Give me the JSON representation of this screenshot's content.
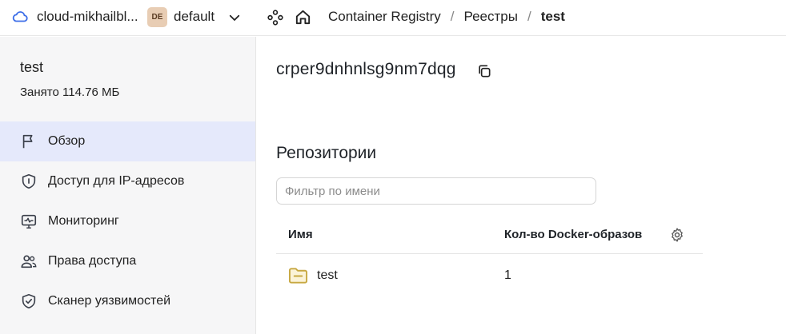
{
  "header": {
    "cloud_name": "cloud-mikhailbl...",
    "folder_badge": "DE",
    "folder_name": "default",
    "breadcrumbs": [
      "Container Registry",
      "Реестры",
      "test"
    ],
    "separator": "/",
    "icons": [
      "cloud-icon",
      "chevron-down-icon",
      "services-icon",
      "home-icon"
    ]
  },
  "sidebar": {
    "title": "test",
    "subtitle": "Занято 114.76 МБ",
    "items": [
      {
        "label": "Обзор",
        "icon": "flag-icon",
        "active": true
      },
      {
        "label": "Доступ для IP-адресов",
        "icon": "shield-icon",
        "active": false
      },
      {
        "label": "Мониторинг",
        "icon": "monitor-icon",
        "active": false
      },
      {
        "label": "Права доступа",
        "icon": "users-icon",
        "active": false
      },
      {
        "label": "Сканер уязвимостей",
        "icon": "shield-check-icon",
        "active": false
      }
    ]
  },
  "main": {
    "registry_id": "crper9dnhnlsg9nm7dqg",
    "repositories_title": "Репозитории",
    "filter": {
      "placeholder": "Фильтр по имени",
      "value": ""
    },
    "table": {
      "columns": [
        "Имя",
        "Кол-во Docker-образов"
      ],
      "rows": [
        {
          "name": "test",
          "count": "1"
        }
      ]
    }
  },
  "colors": {
    "active_bg": "#e5e9fb",
    "sidebar_bg": "#f6f6f7",
    "folder_icon": "#c7a842",
    "cloud_icon": "#3d6ee8",
    "badge_bg": "#e8cdb4"
  }
}
